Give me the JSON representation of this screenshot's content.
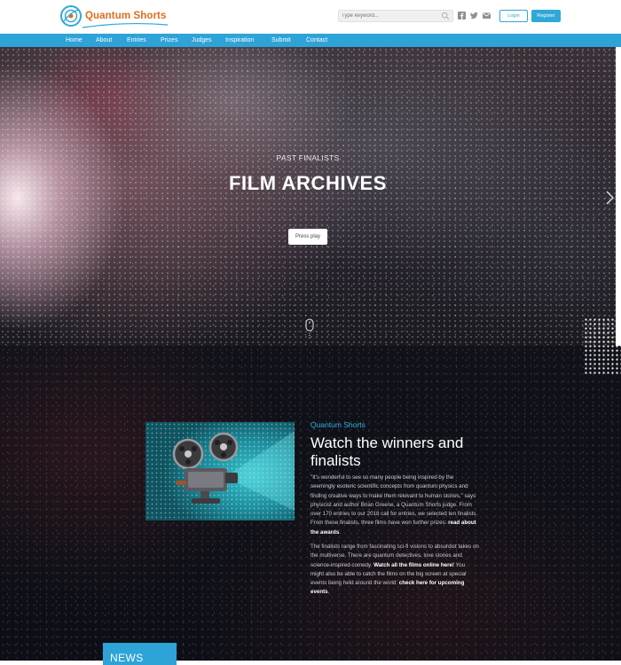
{
  "header": {
    "logo_text": "Quantum Shorts",
    "search_placeholder": "Type keyword...",
    "login_label": "Login",
    "register_label": "Register",
    "social_icons": [
      "facebook-icon",
      "twitter-icon",
      "email-icon"
    ]
  },
  "nav": {
    "items": [
      "Home",
      "About",
      "Entries",
      "Prizes",
      "Judges",
      "Inspiration",
      "Submit",
      "Contact"
    ]
  },
  "hero": {
    "kicker": "PAST FINALISTS",
    "title": "FILM ARCHIVES",
    "button_label": "Press play"
  },
  "section": {
    "kicker": "Quantum Shorts",
    "title": "Watch the winners and finalists",
    "para1_text": "\"It's wonderful to see so many people being inspired by the seemingly esoteric scientific concepts from quantum physics and finding creative ways to make them relevant to human stories,\" says physicist and author Brian Greene, a Quantum Shorts judge. From over 170 entries to our 2018 call for entries, we selected ten finalists. From these finalists, three films have won further prizes:",
    "para1_link": "read about the awards",
    "para1_end": ".",
    "para2_text": "The finalists range from fascinating sci-fi visions to absurdist takes on the multiverse. There are quantum detectives, love stories and science-inspired comedy.",
    "para2_link": "Watch all the films online here!",
    "para2_mid": "You might also be able to catch the films on the big screen at special events being held around the world:",
    "para2_link2": "check here for upcoming events",
    "para2_end": "."
  },
  "news": {
    "label": "NEWS"
  },
  "colors": {
    "accent": "#2da3d7",
    "logo_orange": "#e06c1b",
    "kicker_blue": "#2fb1e3"
  }
}
